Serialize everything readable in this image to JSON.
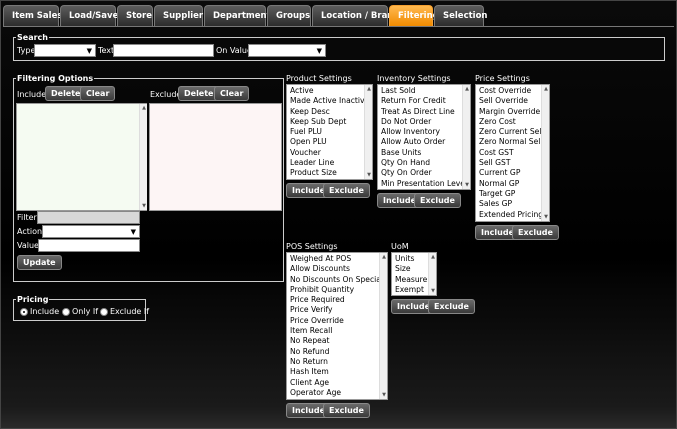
{
  "tabs": [
    "Item Sales",
    "Load/Save",
    "Store",
    "Supplier",
    "Department",
    "Groups",
    "Location / Brand",
    "Filtering",
    "Selection"
  ],
  "active_tab": "Filtering",
  "search": {
    "legend": "Search",
    "type_label": "Type",
    "text_label": "Text",
    "on_value_label": "On Value"
  },
  "filtering_options": {
    "legend": "Filtering Options",
    "include_label": "Include",
    "exclude_label": "Exclude",
    "delete_label": "Delete",
    "clear_label": "Clear",
    "filter_label": "Filter",
    "action_label": "Action",
    "value_label": "Value",
    "update_label": "Update",
    "include_color": "#f5fbf2",
    "exclude_color": "#fdf5f5"
  },
  "pricing": {
    "legend": "Pricing",
    "options": [
      "Include",
      "Only If",
      "Exclude If"
    ],
    "selected": "Include"
  },
  "product_settings": {
    "title": "Product Settings",
    "items": [
      "Active",
      "Made Active Inactive",
      "Keep Desc",
      "Keep Sub Dept",
      "Fuel PLU",
      "Open PLU",
      "Voucher",
      "Leader Line",
      "Product Size"
    ]
  },
  "inventory_settings": {
    "title": "Inventory Settings",
    "items": [
      "Last Sold",
      "Return For Credit",
      "Treat As Direct Line",
      "Do Not Order",
      "Allow Inventory",
      "Allow Auto Order",
      "Base Units",
      "Qty On Hand",
      "Qty On Order",
      "Min Presentation Level"
    ]
  },
  "price_settings": {
    "title": "Price Settings",
    "items": [
      "Cost Override",
      "Sell Override",
      "Margin Override",
      "Zero Cost",
      "Zero Current Sell",
      "Zero Normal Sell",
      "Cost GST",
      "Sell GST",
      "Current GP",
      "Normal GP",
      "Target GP",
      "Sales GP",
      "Extended Pricing"
    ]
  },
  "pos_settings": {
    "title": "POS Settings",
    "items": [
      "Weighed At POS",
      "Allow Discounts",
      "No Discounts On Special",
      "Prohibit Quantity",
      "Price Required",
      "Price Verify",
      "Price Override",
      "Item Recall",
      "No Repeat",
      "No Refund",
      "No Return",
      "Hash Item",
      "Client Age",
      "Operator Age"
    ]
  },
  "uom": {
    "title": "UoM",
    "items": [
      "Units",
      "Size",
      "Measure",
      "Exempt"
    ]
  },
  "buttons": {
    "include": "Include",
    "exclude": "Exclude"
  }
}
